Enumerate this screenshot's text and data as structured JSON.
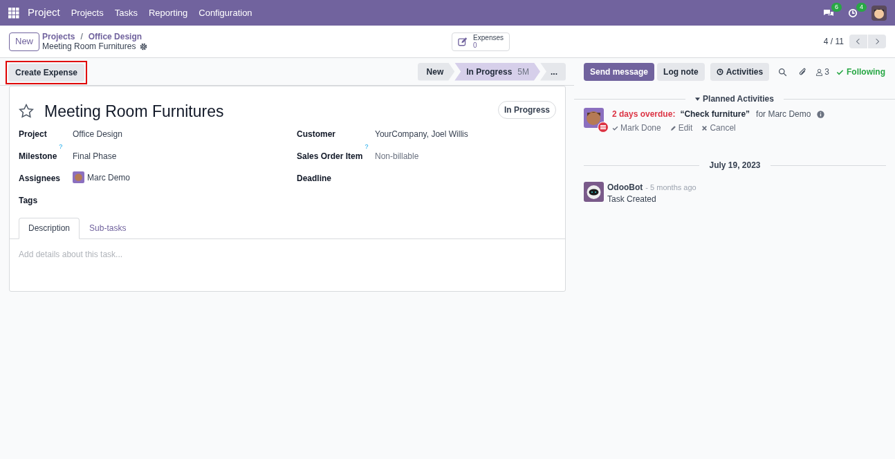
{
  "navbar": {
    "app": "Project",
    "menu": [
      "Projects",
      "Tasks",
      "Reporting",
      "Configuration"
    ],
    "messages_badge": "6",
    "activities_badge": "4"
  },
  "control_panel": {
    "new_button": "New",
    "breadcrumbs": [
      "Projects",
      "Office Design"
    ],
    "separator": "/",
    "record_name": "Meeting Room Furnitures",
    "smart_button": {
      "label": "Expenses",
      "value": "0"
    },
    "pager": "4 / 11"
  },
  "action_button": {
    "label": "Create Expense",
    "highlighted": true
  },
  "stages": [
    {
      "label": "New",
      "selected": false
    },
    {
      "label": "In Progress",
      "duration": "5M",
      "selected": true
    },
    {
      "label": "...",
      "selected": false
    }
  ],
  "chatter_buttons": [
    {
      "label": "Send message",
      "primary": true,
      "icon": false
    },
    {
      "label": "Log note",
      "primary": false,
      "icon": false
    },
    {
      "label": "Activities",
      "primary": false,
      "icon": true
    }
  ],
  "followers": "3",
  "following": "Following",
  "form": {
    "starred": false,
    "title": "Meeting Room Furnitures",
    "status": "In Progress",
    "left_fields": [
      {
        "label": "Project",
        "value": "Office Design",
        "kind": "text"
      },
      {
        "label": "Milestone",
        "help": "?",
        "value": "Final Phase",
        "kind": "text"
      },
      {
        "label": "Assignees",
        "value": "Marc Demo",
        "kind": "avatar"
      },
      {
        "label": "Tags",
        "kind": "empty"
      }
    ],
    "right_fields": [
      {
        "label": "Customer",
        "value": "YourCompany, Joel Willis",
        "kind": "text"
      },
      {
        "label": "Sales Order Item",
        "help": "?",
        "value": "Non-billable",
        "kind": "muted"
      },
      {
        "label": "Deadline",
        "kind": "empty"
      }
    ],
    "tabs": [
      {
        "label": "Description",
        "selected": true
      },
      {
        "label": "Sub-tasks",
        "selected": false
      }
    ],
    "placeholder": "Add details about this task..."
  },
  "planned_activities": {
    "header": "Planned Activities",
    "overdue": "2 days overdue:",
    "summary": "“Check furniture”",
    "assignee": "for Marc Demo",
    "actions": [
      "Mark Done",
      "Edit",
      "Cancel"
    ]
  },
  "date_separator": "July 19, 2023",
  "message": {
    "author": "OdooBot",
    "time": "- 5 months ago",
    "body": "Task Created"
  }
}
